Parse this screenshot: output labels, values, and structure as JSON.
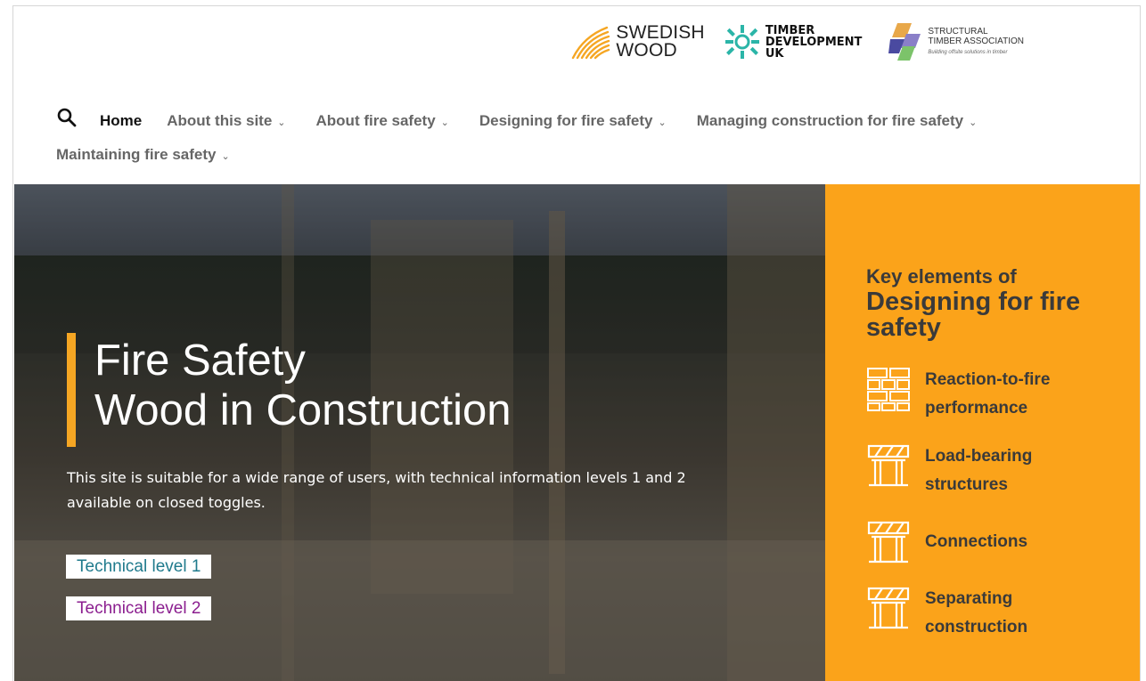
{
  "header": {
    "logos": [
      {
        "name": "Swedish Wood",
        "lines": [
          "SWEDISH",
          "WOOD"
        ]
      },
      {
        "name": "Timber Development UK",
        "lines": [
          "TIMBER",
          "DEVELOPMENT",
          "UK"
        ]
      },
      {
        "name": "Structural Timber Association",
        "lines": [
          "STRUCTURAL",
          "TIMBER ASSOCIATION"
        ],
        "tagline": "Building offsite solutions in timber"
      }
    ]
  },
  "nav": {
    "row1": [
      {
        "label": "Home",
        "active": true,
        "dropdown": false
      },
      {
        "label": "About this site",
        "dropdown": true
      },
      {
        "label": "About fire safety",
        "dropdown": true
      },
      {
        "label": "Designing for fire safety",
        "dropdown": true
      },
      {
        "label": "Managing construction for fire safety",
        "dropdown": true
      }
    ],
    "row2": [
      {
        "label": "Maintaining fire safety",
        "dropdown": true
      }
    ],
    "chevron": "⌄"
  },
  "hero": {
    "title_line1": "Fire Safety",
    "title_line2": "Wood in Construction",
    "description": "This site is suitable for a wide range of users, with technical information levels 1 and 2 available on closed toggles.",
    "buttons": [
      {
        "label": "Technical level 1",
        "color": "#1f7a8c"
      },
      {
        "label": "Technical level 2",
        "color": "#8b1e8f"
      }
    ]
  },
  "panel": {
    "intro": "Key elements of",
    "title": "Designing for fire safety",
    "items": [
      {
        "label_line1": "Reaction-to-fire",
        "label_line2": "performance",
        "icon": "brick-wall-icon"
      },
      {
        "label_line1": "Load-bearing",
        "label_line2": "structures",
        "icon": "timber-frame-icon"
      },
      {
        "label_line1": "Connections",
        "label_line2": "",
        "icon": "timber-frame-icon"
      },
      {
        "label_line1": "Separating",
        "label_line2": "construction",
        "icon": "timber-frame-icon"
      }
    ],
    "background": "#fba31a"
  },
  "colors": {
    "accent": "#f5a623",
    "tech1": "#1f7a8c",
    "tech2": "#8b1e8f"
  }
}
